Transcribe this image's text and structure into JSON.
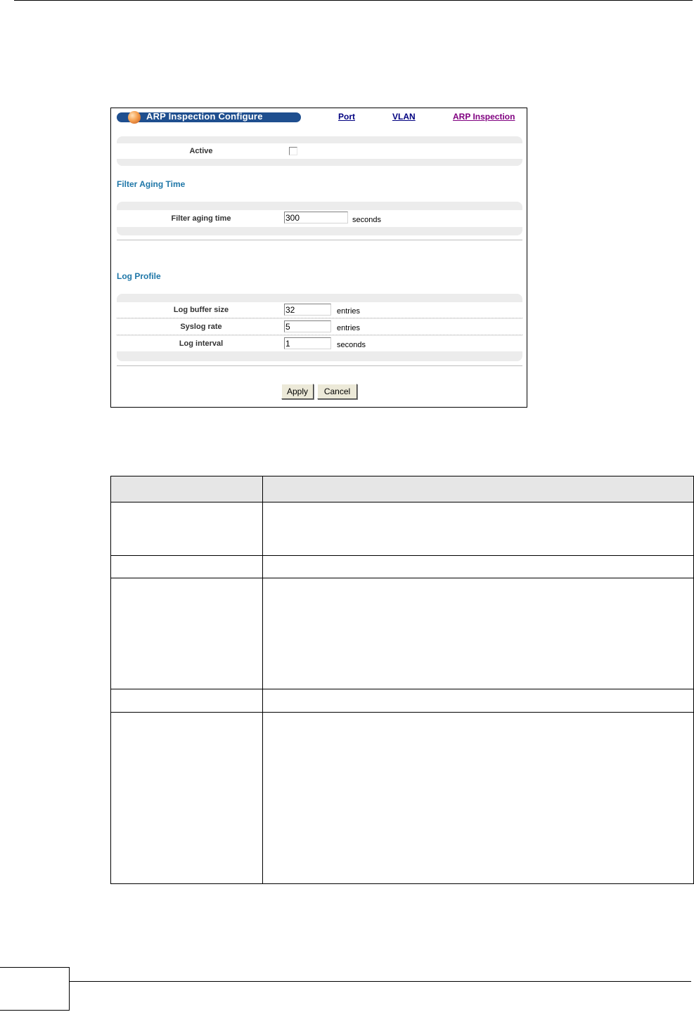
{
  "panel": {
    "title": "ARP Inspection Configure",
    "nav": [
      {
        "label": "Port"
      },
      {
        "label": "VLAN"
      },
      {
        "label": "ARP Inspection"
      }
    ],
    "active_label": "Active",
    "filter_heading": "Filter Aging Time",
    "filter_label": "Filter aging time",
    "filter_value": "300",
    "filter_unit": "seconds",
    "log_heading": "Log Profile",
    "log_rows": [
      {
        "label": "Log buffer size",
        "value": "32",
        "unit": "entries"
      },
      {
        "label": "Syslog rate",
        "value": "5",
        "unit": "entries"
      },
      {
        "label": "Log interval",
        "value": "1",
        "unit": "seconds"
      }
    ],
    "apply_label": "Apply",
    "cancel_label": "Cancel"
  }
}
